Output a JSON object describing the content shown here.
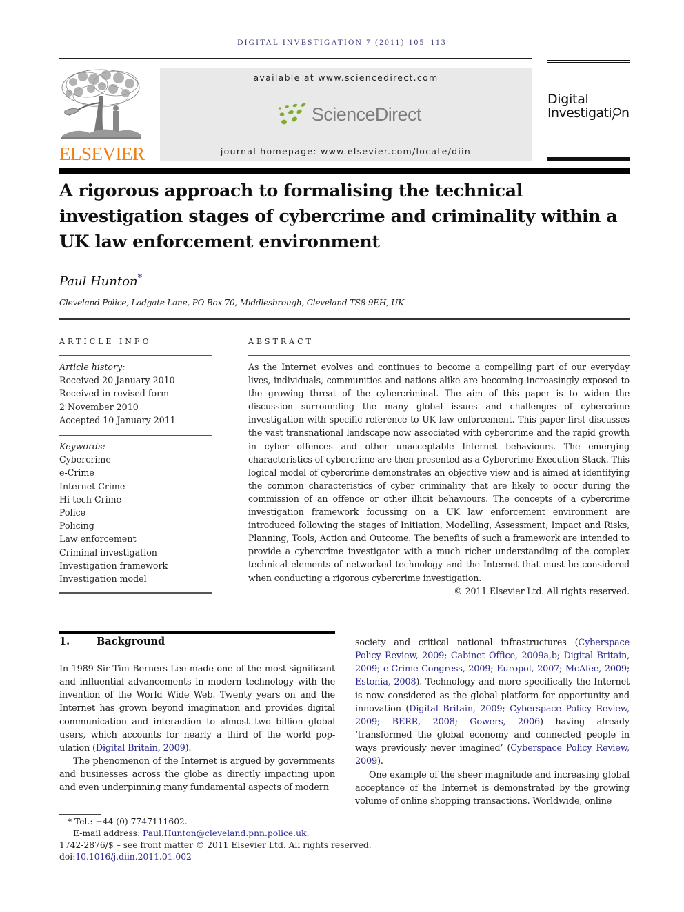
{
  "header": {
    "running_head": "Digital Investigation 7 (2011) 105–113",
    "publisher_logo_text": "ELSEVIER",
    "available_at": "available at www.sciencedirect.com",
    "sciencedirect_logo_text": "ScienceDirect",
    "journal_homepage": "journal homepage: www.elsevier.com/locate/diin",
    "journal_logo": {
      "line1": "Digital",
      "line2_prefix": "Investigati",
      "line2_suffix": "n"
    },
    "colors": {
      "elsevier_orange": "#f07f12",
      "sciencedirect_green": "#7fad2b",
      "running_head": "#3a3a78",
      "link_blue": "#2a2a8c"
    }
  },
  "article": {
    "title": "A rigorous approach to formalising the technical investigation stages of cybercrime and criminality within a UK law enforcement environment",
    "author": "Paul Hunton",
    "author_mark": "*",
    "affiliation": "Cleveland Police, Ladgate Lane, PO Box 70, Middlesbrough, Cleveland TS8 9EH, UK"
  },
  "article_info": {
    "heading": "ARTICLE INFO",
    "history_label": "Article history:",
    "history": [
      "Received 20 January 2010",
      "Received in revised form",
      "2 November 2010",
      "Accepted 10 January 2011"
    ],
    "keywords_label": "Keywords:",
    "keywords": [
      "Cybercrime",
      "e-Crime",
      "Internet Crime",
      "Hi-tech Crime",
      "Police",
      "Policing",
      "Law enforcement",
      "Criminal investigation",
      "Investigation framework",
      "Investigation model"
    ]
  },
  "abstract": {
    "heading": "ABSTRACT",
    "text": "As the Internet evolves and continues to become a compelling part of our everyday lives, individuals, communities and nations alike are becoming increasingly exposed to the growing threat of the cybercriminal. The aim of this paper is to widen the discussion surrounding the many global issues and challenges of cybercrime investigation with specific reference to UK law enforcement. This paper first discusses the vast transnational landscape now associated with cybercrime and the rapid growth in cyber offences and other unacceptable Internet behaviours. The emerging characteristics of cybercrime are then presented as a Cybercrime Execution Stack. This logical model of cybercrime demonstrates an objective view and is aimed at identifying the common characteristics of cyber criminality that are likely to occur during the commission of an offence or other illicit behaviours. The concepts of a cybercrime investigation framework focussing on a UK law enforcement environment are introduced following the stages of Initiation, Modelling, Assessment, Impact and Risks, Planning, Tools, Action and Outcome. The benefits of such a framework are intended to provide a cybercrime investigator with a much richer understanding of the complex technical elements of networked technology and the Internet that must be considered when conducting a rigorous cybercrime investigation.",
    "copyright": "© 2011 Elsevier Ltd. All rights reserved."
  },
  "section1": {
    "number": "1.",
    "title": "Background",
    "p1": {
      "text": "In 1989 Sir Tim Berners-Lee made one of the most significant and influential advancements in modern technology with the invention of the World Wide Web. Twenty years on and the Internet has grown beyond imagination and provides digital communication and interaction to almost two billion global users, which accounts for nearly a third of the world pop-ulation (",
      "ref1": "Digital Britain, 2009",
      "end": ")."
    },
    "p2": {
      "text": "The phenomenon of the Internet is argued by governments and businesses across the globe as directly impacting upon and even underpinning many fundamental aspects of modern society and critical national infrastructures (",
      "refs1": "Cyberspace Policy Review, 2009; Cabinet Office, 2009a,b; Digital Britain, 2009; e-Crime Congress, 2009; Europol, 2007; McAfee, 2009; Estonia, 2008",
      "mid1": "). Technology and more specifically the Internet is now considered as the global platform for opportunity and innovation (",
      "refs2": "Digital Britain, 2009; Cyberspace Policy Review, 2009; BERR, 2008; Gowers, 2006",
      "mid2": ") having already ‘transformed the global economy and connected people in ways previously never imagined’ (",
      "refs3": "Cyberspace Policy Review, 2009",
      "end": ")."
    },
    "p3": {
      "text": "One example of the sheer magnitude and increasing global acceptance of the Internet is demonstrated by the growing volume of online shopping transactions. Worldwide, online"
    }
  },
  "footnotes": {
    "star": "*",
    "tel": "Tel.: +44 (0) 7747111602.",
    "email_label": "E-mail address: ",
    "email": "Paul.Hunton@cleveland.pnn.police.uk",
    "email_end": ".",
    "issn": "1742-2876/$ – see front matter © 2011 Elsevier Ltd. All rights reserved.",
    "doi_label": "doi:",
    "doi": "10.1016/j.diin.2011.01.002"
  }
}
